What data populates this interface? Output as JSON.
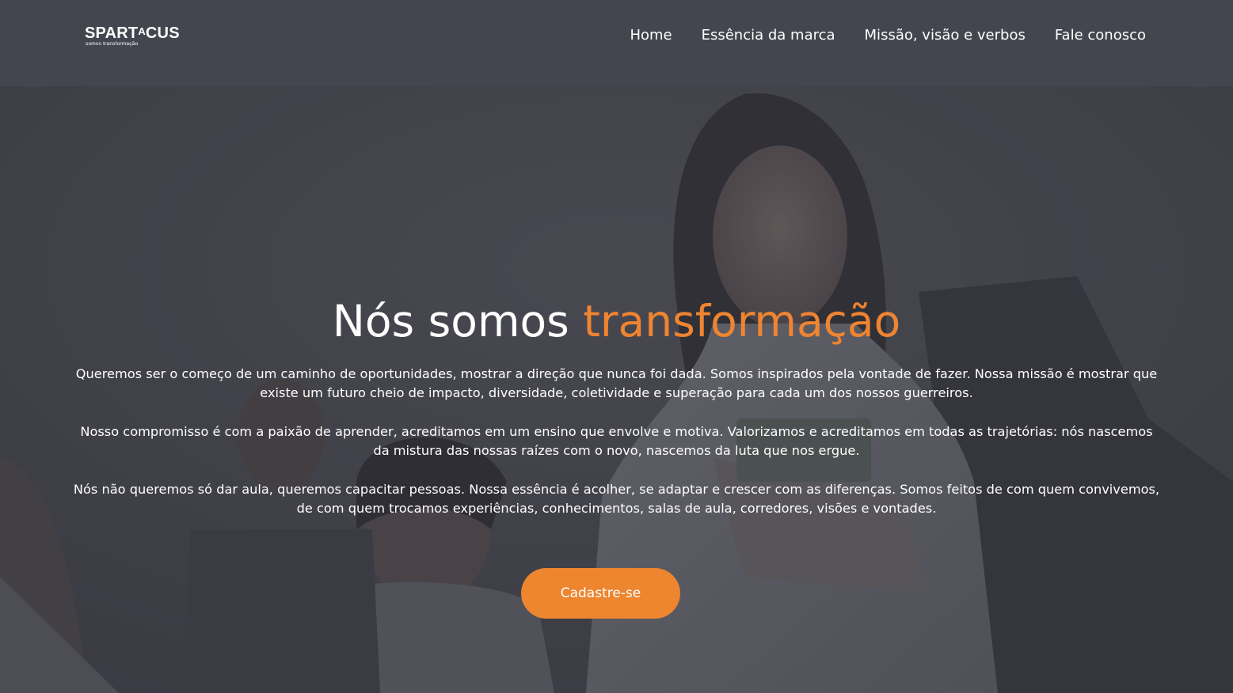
{
  "header": {
    "logo": {
      "name": "SPARTACUS",
      "tagline": "somos transformação"
    },
    "nav": [
      "Home",
      "Essência da marca",
      "Missão, visão e verbos",
      "Fale conosco"
    ]
  },
  "hero": {
    "title_plain": "Nós somos",
    "title_accent": "transformação",
    "paragraphs": [
      "Queremos ser o começo de um caminho de oportunidades, mostrar a direção que nunca foi dada. Somos inspirados pela vontade de fazer. Nossa missão é mostrar que existe um futuro cheio de impacto, diversidade, coletividade e superação para cada um dos nossos guerreiros.",
      "Nosso compromisso é com a paixão de aprender, acreditamos em um ensino que envolve e motiva. Valorizamos e acreditamos em todas as trajetórias: nós nascemos da mistura das nossas raízes com o novo, nascemos da luta que nos ergue.",
      "Nós não queremos só dar aula, queremos capacitar pessoas. Nossa essência é acolher, se adaptar e crescer com as diferenças. Somos feitos de com quem convivemos, de com quem trocamos experiências, conhecimentos, salas de aula, corredores, visões e vontades."
    ],
    "cta_label": "Cadastre-se"
  },
  "colors": {
    "header_bg": "#44464f",
    "hero_overlay": "#3a3b44",
    "accent": "#ef8431",
    "text": "#ffffff"
  }
}
